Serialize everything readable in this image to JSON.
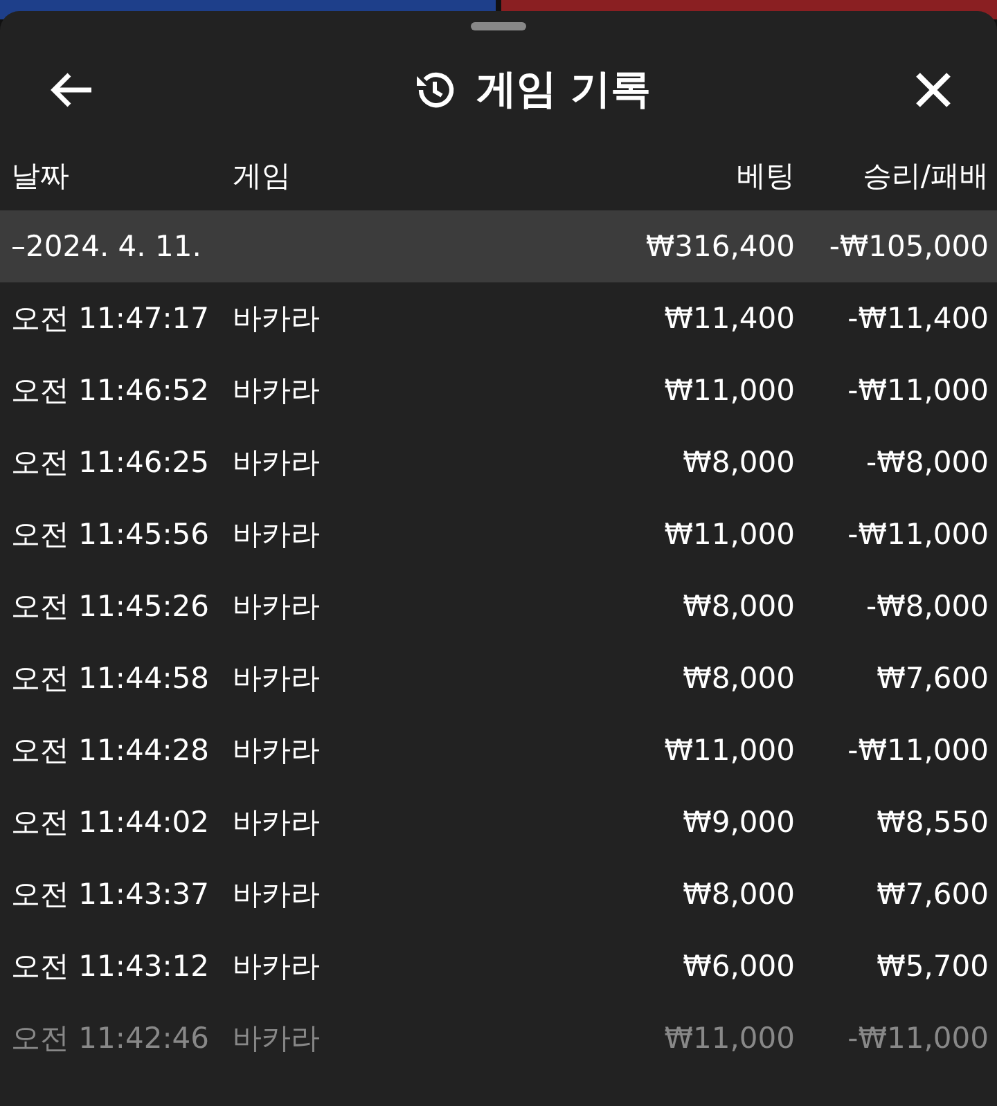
{
  "header": {
    "title": "게임 기록"
  },
  "columns": [
    "날짜",
    "게임",
    "베팅",
    "승리/패배"
  ],
  "summary": {
    "date": "–2024. 4. 11.",
    "bet": "₩316,400",
    "result": "-₩105,000"
  },
  "rows": [
    {
      "time": "오전 11:47:17",
      "game": "바카라",
      "bet": "₩11,400",
      "result": "-₩11,400"
    },
    {
      "time": "오전 11:46:52",
      "game": "바카라",
      "bet": "₩11,000",
      "result": "-₩11,000"
    },
    {
      "time": "오전 11:46:25",
      "game": "바카라",
      "bet": "₩8,000",
      "result": "-₩8,000"
    },
    {
      "time": "오전 11:45:56",
      "game": "바카라",
      "bet": "₩11,000",
      "result": "-₩11,000"
    },
    {
      "time": "오전 11:45:26",
      "game": "바카라",
      "bet": "₩8,000",
      "result": "-₩8,000"
    },
    {
      "time": "오전 11:44:58",
      "game": "바카라",
      "bet": "₩8,000",
      "result": "₩7,600"
    },
    {
      "time": "오전 11:44:28",
      "game": "바카라",
      "bet": "₩11,000",
      "result": "-₩11,000"
    },
    {
      "time": "오전 11:44:02",
      "game": "바카라",
      "bet": "₩9,000",
      "result": "₩8,550"
    },
    {
      "time": "오전 11:43:37",
      "game": "바카라",
      "bet": "₩8,000",
      "result": "₩7,600"
    },
    {
      "time": "오전 11:43:12",
      "game": "바카라",
      "bet": "₩6,000",
      "result": "₩5,700"
    },
    {
      "time": "오전 11:42:46",
      "game": "바카라",
      "bet": "₩11,000",
      "result": "-₩11,000"
    }
  ]
}
